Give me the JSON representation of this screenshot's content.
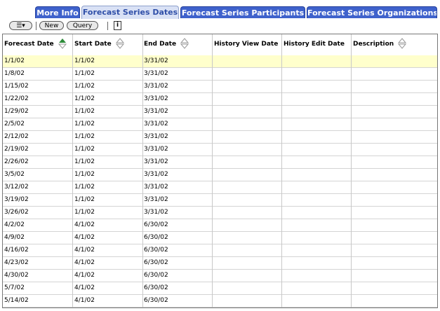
{
  "tabs": [
    "More Info",
    "Forecast Series Dates",
    "Forecast Series Participants",
    "Forecast Series Organizations"
  ],
  "active_tab": 1,
  "toolbar": {
    "menu_label": "☰▾",
    "new_label": "New",
    "query_label": "Query"
  },
  "columns": [
    "Forecast Date",
    "Start Date",
    "End Date",
    "History View Date",
    "History Edit Date",
    "Description"
  ],
  "rows": [
    [
      "1/1/02",
      "1/1/02",
      "3/31/02",
      "",
      "",
      ""
    ],
    [
      "1/8/02",
      "1/1/02",
      "3/31/02",
      "",
      "",
      ""
    ],
    [
      "1/15/02",
      "1/1/02",
      "3/31/02",
      "",
      "",
      ""
    ],
    [
      "1/22/02",
      "1/1/02",
      "3/31/02",
      "",
      "",
      ""
    ],
    [
      "1/29/02",
      "1/1/02",
      "3/31/02",
      "",
      "",
      ""
    ],
    [
      "2/5/02",
      "1/1/02",
      "3/31/02",
      "",
      "",
      ""
    ],
    [
      "2/12/02",
      "1/1/02",
      "3/31/02",
      "",
      "",
      ""
    ],
    [
      "2/19/02",
      "1/1/02",
      "3/31/02",
      "",
      "",
      ""
    ],
    [
      "2/26/02",
      "1/1/02",
      "3/31/02",
      "",
      "",
      ""
    ],
    [
      "3/5/02",
      "1/1/02",
      "3/31/02",
      "",
      "",
      ""
    ],
    [
      "3/12/02",
      "1/1/02",
      "3/31/02",
      "",
      "",
      ""
    ],
    [
      "3/19/02",
      "1/1/02",
      "3/31/02",
      "",
      "",
      ""
    ],
    [
      "3/26/02",
      "1/1/02",
      "3/31/02",
      "",
      "",
      ""
    ],
    [
      "4/2/02",
      "4/1/02",
      "6/30/02",
      "",
      "",
      ""
    ],
    [
      "4/9/02",
      "4/1/02",
      "6/30/02",
      "",
      "",
      ""
    ],
    [
      "4/16/02",
      "4/1/02",
      "6/30/02",
      "",
      "",
      ""
    ],
    [
      "4/23/02",
      "4/1/02",
      "6/30/02",
      "",
      "",
      ""
    ],
    [
      "4/30/02",
      "4/1/02",
      "6/30/02",
      "",
      "",
      ""
    ],
    [
      "5/7/02",
      "4/1/02",
      "6/30/02",
      "",
      "",
      ""
    ],
    [
      "5/14/02",
      "4/1/02",
      "6/30/02",
      "",
      "",
      ""
    ]
  ],
  "selected_row": 0,
  "colors": {
    "tab": "#3f62cc",
    "selected_row": "#ffffcc",
    "sort_active": "#2e8b3a"
  }
}
